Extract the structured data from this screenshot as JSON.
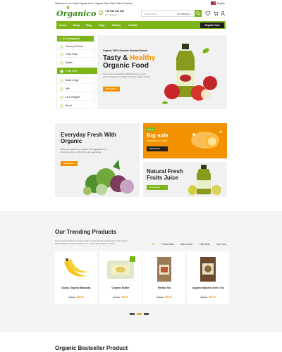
{
  "topbar": {
    "welcome": "Welcome to our Fresh Organic store. Organic Store Best Online Partners",
    "language": "English"
  },
  "header": {
    "logo": "Organico",
    "phone": "+13 540 540 690",
    "hours": "24/7 Support",
    "search_placeholder": "Search here...",
    "search_category": "All Category"
  },
  "nav": {
    "items": [
      "Home",
      "Shop",
      "Blog",
      "Page",
      "Gallery",
      "Contact"
    ],
    "register_label": "Register Now"
  },
  "sidebar": {
    "heading": "All Categories",
    "items": [
      {
        "label": "Grocery & Frozen"
      },
      {
        "label": "Fresh Fruits"
      },
      {
        "label": "Salads"
      },
      {
        "label": "Fresh Meat"
      },
      {
        "label": "Butter & Egg"
      },
      {
        "label": "Milk"
      },
      {
        "label": "Oil & Vinegars"
      },
      {
        "label": "Bread"
      }
    ]
  },
  "hero": {
    "tag": "Organic 100% Genuine Product Earned",
    "title_part1": "Tasty & ",
    "title_highlight": "Healthy",
    "title_line2": "Organic Food",
    "description": "Dam amet, consectetur adipiscing elit, sed do eiusmod tempor incididunt ut dolore magna aliqua.",
    "button_label": "Shop Now"
  },
  "banners": {
    "fresh": {
      "title": "Everyday Fresh With Organic",
      "description": "Shop our selection of organic fruit vegetables in a discounted price. 10% off on all vegetables.",
      "button_label": "Shop Now"
    },
    "sale": {
      "badge": "Best in",
      "title": "Big sale",
      "subtitle": "Orange & Juice",
      "button_label": "Shop Now"
    },
    "juice": {
      "title": "Natural Fresh Fruits Juice",
      "button_label": "Shop Now"
    }
  },
  "trending": {
    "title": "Our Trending Products",
    "description": "Sed ut lacinia id dictum integra aliquip. Duis gravida suspendisse id dui ipsum. Sed vestibulum etiam fermentum ut. Lorem ipsum dolor sit amet.",
    "tabs": [
      {
        "label": "All",
        "active": true
      },
      {
        "label": "Food Drinks",
        "active": false
      },
      {
        "label": "Milk Cream",
        "active": false
      },
      {
        "label": "Fish Meat",
        "active": false
      },
      {
        "label": "Dry Food",
        "active": false
      }
    ],
    "products": [
      {
        "name": "Dusky Organic Bananas",
        "old_price": "$65.00",
        "new_price": "$60.00",
        "icon": "banana-icon"
      },
      {
        "name": "Organic Butter",
        "old_price": "$70.00",
        "new_price": "$63.00",
        "icon": "butter-icon"
      },
      {
        "name": "Herbal Tea",
        "old_price": "$55.00",
        "new_price": "$50.00",
        "icon": "tea-bag-icon"
      },
      {
        "name": "Organic Matcha Green Tea",
        "old_price": "$50.00",
        "new_price": "$45.00",
        "icon": "matcha-icon"
      }
    ]
  },
  "bestseller": {
    "title": "Organic Bestseller Product"
  },
  "colors": {
    "green": "#7cb518",
    "orange": "#f29200",
    "dark": "#1f1f1f",
    "light_bg": "#f1f1f1"
  }
}
